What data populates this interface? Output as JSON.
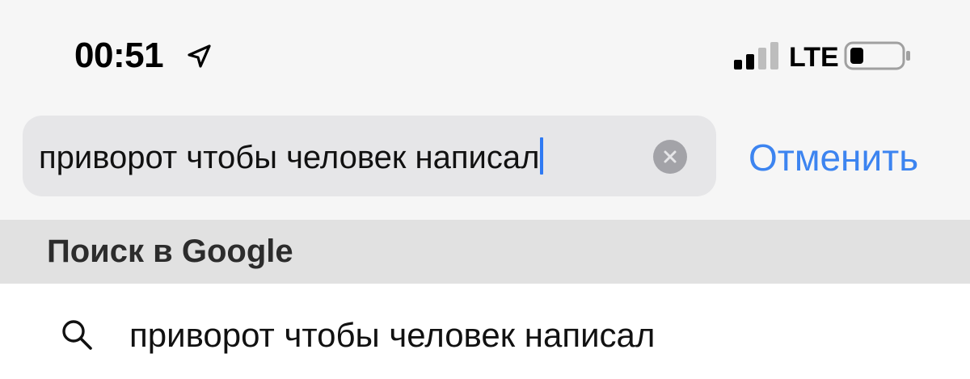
{
  "status_bar": {
    "time": "00:51",
    "location_icon": "location-arrow-icon",
    "signal_icon": "cellular-signal-icon",
    "network": "LTE",
    "battery_icon": "battery-low-icon"
  },
  "search": {
    "query": "приворот чтобы человек написал",
    "clear_icon": "clear-icon",
    "cancel_label": "Отменить"
  },
  "section": {
    "title": "Поиск в Google"
  },
  "suggestions": [
    {
      "icon": "search-icon",
      "text": "приворот чтобы человек написал"
    }
  ],
  "colors": {
    "accent": "#3c84f0",
    "caret": "#2f7af3",
    "field_bg": "#e6e6e8",
    "header_bg": "#e1e1e1"
  }
}
